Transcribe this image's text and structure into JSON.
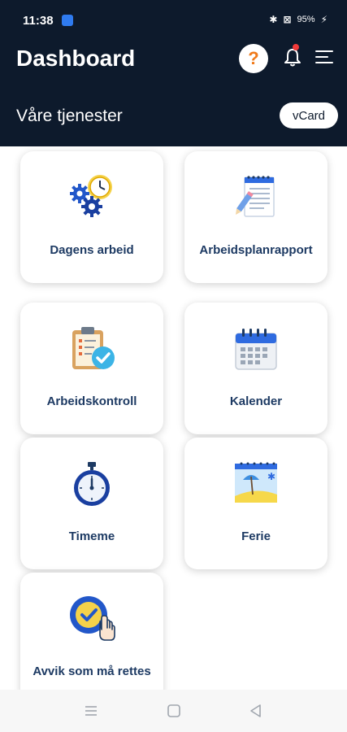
{
  "status_bar": {
    "time": "11:38",
    "battery": "95%",
    "right_glyphs": [
      "✱",
      "⊠"
    ]
  },
  "header": {
    "title": "Dashboard",
    "help_symbol": "?"
  },
  "section": {
    "title": "Våre tjenester",
    "vcard_label": "vCard"
  },
  "cards": [
    {
      "label": "Dagens arbeid",
      "icon": "gears-clock-icon"
    },
    {
      "label": "Arbeidsplanrapport",
      "icon": "notepad-pencil-icon"
    },
    {
      "label": "Arbeidskontroll",
      "icon": "clipboard-check-icon"
    },
    {
      "label": "Kalender",
      "icon": "calendar-icon"
    },
    {
      "label": "Timeme",
      "icon": "stopwatch-icon"
    },
    {
      "label": "Ferie",
      "icon": "beach-vacation-icon"
    },
    {
      "label": "Avvik som må rettes",
      "icon": "check-hand-icon"
    }
  ],
  "colors": {
    "header_bg": "#0d1a2c",
    "card_label": "#1d3a63",
    "accent_orange": "#f07a1a",
    "icon_blue": "#2257c9"
  }
}
